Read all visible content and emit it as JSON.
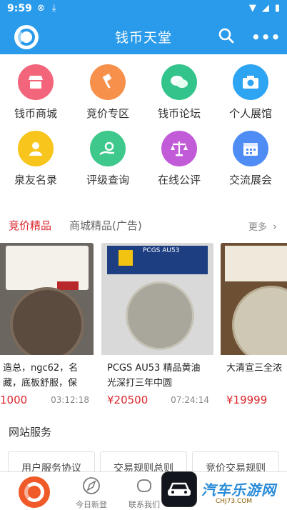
{
  "status_bar": {
    "time": "9:59"
  },
  "header": {
    "title": "钱币天堂"
  },
  "grid": [
    {
      "label": "钱币商城",
      "icon": "shop-icon",
      "color": "#f2657a"
    },
    {
      "label": "竞价专区",
      "icon": "gavel-icon",
      "color": "#f7904a"
    },
    {
      "label": "钱币论坛",
      "icon": "chat-icon",
      "color": "#33c48c"
    },
    {
      "label": "个人展馆",
      "icon": "camera-icon",
      "color": "#2ea5f3"
    },
    {
      "label": "泉友名录",
      "icon": "user-icon",
      "color": "#f8c51c"
    },
    {
      "label": "评级查询",
      "icon": "search-hand-icon",
      "color": "#3fc88b"
    },
    {
      "label": "在线公评",
      "icon": "scales-icon",
      "color": "#c25bd8"
    },
    {
      "label": "交流展会",
      "icon": "calendar-icon",
      "color": "#4f8df5"
    }
  ],
  "tabs": {
    "active": "竞价精品",
    "inactive": "商城精品(广告)",
    "more": "更多"
  },
  "cards": [
    {
      "name": "造总，ngc62，名藏，底板舒服，保",
      "price": "1000",
      "time": "03:12:18"
    },
    {
      "name": "PCGS AU53 精品黄油光深打三年中圆",
      "price": "¥20500",
      "time": "07:24:14",
      "slab_grade": "PCGS AU53"
    },
    {
      "name": "大清宣三全浓",
      "price": "¥19999",
      "time": ""
    }
  ],
  "section_title": "网站服务",
  "services": [
    "用户服务协议",
    "交易规则总则",
    "竞价交易规则"
  ],
  "bottom_nav": [
    {
      "label": "",
      "icon": "home-logo-icon"
    },
    {
      "label": "今日新登",
      "icon": "compass-icon"
    },
    {
      "label": "联系我们",
      "icon": "phone-icon"
    }
  ],
  "watermark": {
    "text": "汽车乐游网",
    "url": "CHJ73.COM"
  }
}
